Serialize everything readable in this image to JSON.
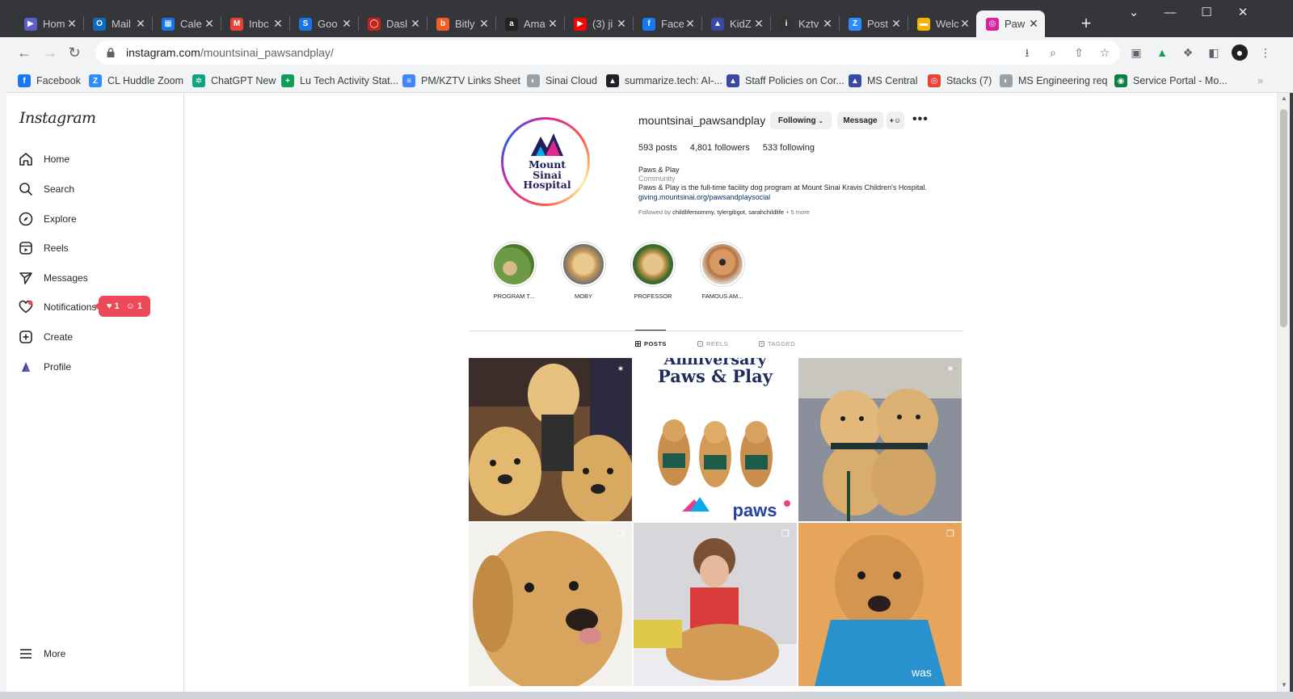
{
  "browser": {
    "tabs": [
      {
        "title": "Hom",
        "icon_text": "▶",
        "icon_color": "#5b5fc7"
      },
      {
        "title": "Mail",
        "icon_text": "O",
        "icon_color": "#0f6cbd"
      },
      {
        "title": "Cale",
        "icon_text": "▦",
        "icon_color": "#1a73e8"
      },
      {
        "title": "Inbc",
        "icon_text": "M",
        "icon_color": "#ea4335"
      },
      {
        "title": "Goo",
        "icon_text": "S",
        "icon_color": "#1a73e8"
      },
      {
        "title": "Dasl",
        "icon_text": "◯",
        "icon_color": "#c5221f"
      },
      {
        "title": "Bitly",
        "icon_text": "b",
        "icon_color": "#ee6123"
      },
      {
        "title": "Ama",
        "icon_text": "a",
        "icon_color": "#222222"
      },
      {
        "title": "(3) ji",
        "icon_text": "▶",
        "icon_color": "#ff0000"
      },
      {
        "title": "Face",
        "icon_text": "f",
        "icon_color": "#1877f2"
      },
      {
        "title": "KidZ",
        "icon_text": "▲",
        "icon_color": "#3b4aa1"
      },
      {
        "title": "Kztv",
        "icon_text": "i",
        "icon_color": "#333333"
      },
      {
        "title": "Post",
        "icon_text": "Z",
        "icon_color": "#2d8cff"
      },
      {
        "title": "Welc",
        "icon_text": "▬",
        "icon_color": "#f4b400"
      },
      {
        "title": "Paw",
        "icon_text": "◎",
        "icon_color": "#d6249f"
      }
    ],
    "new_tab_label": "+",
    "window_controls": [
      "⌄",
      "—",
      "☐",
      "✕"
    ],
    "url_domain": "instagram.com",
    "url_path": "/mountsinai_pawsandplay/",
    "bookmarks": [
      {
        "label": "Facebook",
        "icon_text": "f",
        "icon_color": "#1877f2"
      },
      {
        "label": "CL Huddle Zoom",
        "icon_text": "Z",
        "icon_color": "#2d8cff"
      },
      {
        "label": "ChatGPT New",
        "icon_text": "✲",
        "icon_color": "#10a37f"
      },
      {
        "label": "Lu Tech Activity Stat...",
        "icon_text": "+",
        "icon_color": "#0f9d58"
      },
      {
        "label": "PM/KZTV Links Sheet",
        "icon_text": "≡",
        "icon_color": "#4285f4"
      },
      {
        "label": "Sinai Cloud",
        "icon_text": "◐",
        "icon_color": "#9aa0a6"
      },
      {
        "label": "summarize.tech: AI-...",
        "icon_text": "▲",
        "icon_color": "#202124"
      },
      {
        "label": "Staff Policies on Cor...",
        "icon_text": "▲",
        "icon_color": "#3b4aa1"
      },
      {
        "label": "MS Central",
        "icon_text": "▲",
        "icon_color": "#3b4aa1"
      },
      {
        "label": "Stacks (7)",
        "icon_text": "◎",
        "icon_color": "#ea4335"
      },
      {
        "label": "MS Engineering req",
        "icon_text": "◐",
        "icon_color": "#9aa0a6"
      },
      {
        "label": "Service Portal - Mo...",
        "icon_text": "◉",
        "icon_color": "#0b8043"
      }
    ],
    "bookmarks_overflow": "»"
  },
  "sidebar": {
    "logo": "Instagram",
    "items": [
      {
        "label": "Home"
      },
      {
        "label": "Search"
      },
      {
        "label": "Explore"
      },
      {
        "label": "Reels"
      },
      {
        "label": "Messages"
      },
      {
        "label": "Notifications"
      },
      {
        "label": "Create"
      },
      {
        "label": "Profile"
      }
    ],
    "notification_badge": {
      "likes": "1",
      "follows": "1"
    },
    "more_label": "More"
  },
  "profile": {
    "avatar_text": [
      "Mount",
      "Sinai",
      "Hospital"
    ],
    "username": "mountsinai_pawsandplay",
    "following_button": "Following",
    "message_button": "Message",
    "stats": {
      "posts_count": "593",
      "posts_label": "posts",
      "followers_count": "4,801",
      "followers_label": "followers",
      "following_count": "533",
      "following_label": "following"
    },
    "bio_name": "Paws & Play",
    "bio_category": "Community",
    "bio_text": "Paws & Play is the full-time facility dog program at Mount Sinai Kravis Children's Hospital.",
    "bio_link": "giving.mountsinai.org/pawsandplaysocial",
    "followed_by_prefix": "Followed by",
    "followed_by_names": "childlifemommy, tylergibgot, sarahchildlife",
    "followed_by_more": "+ 5 more"
  },
  "highlights": [
    {
      "label": "PROGRAM T..."
    },
    {
      "label": "MOBY"
    },
    {
      "label": "PROFESSOR"
    },
    {
      "label": "FAMOUS AM..."
    }
  ],
  "profile_tabs": [
    {
      "label": "POSTS"
    },
    {
      "label": "REELS"
    },
    {
      "label": "TAGGED"
    }
  ],
  "posts": {
    "post2_line1": "Anniversary",
    "post2_line2": "Paws & Play",
    "post2_brand": "paws",
    "post6_vest_text": "was"
  },
  "colors": {
    "instagram_red": "#ed4956",
    "link_blue": "#00376b",
    "chrome_dark": "#35363a",
    "chrome_light": "#f1f3f4"
  }
}
